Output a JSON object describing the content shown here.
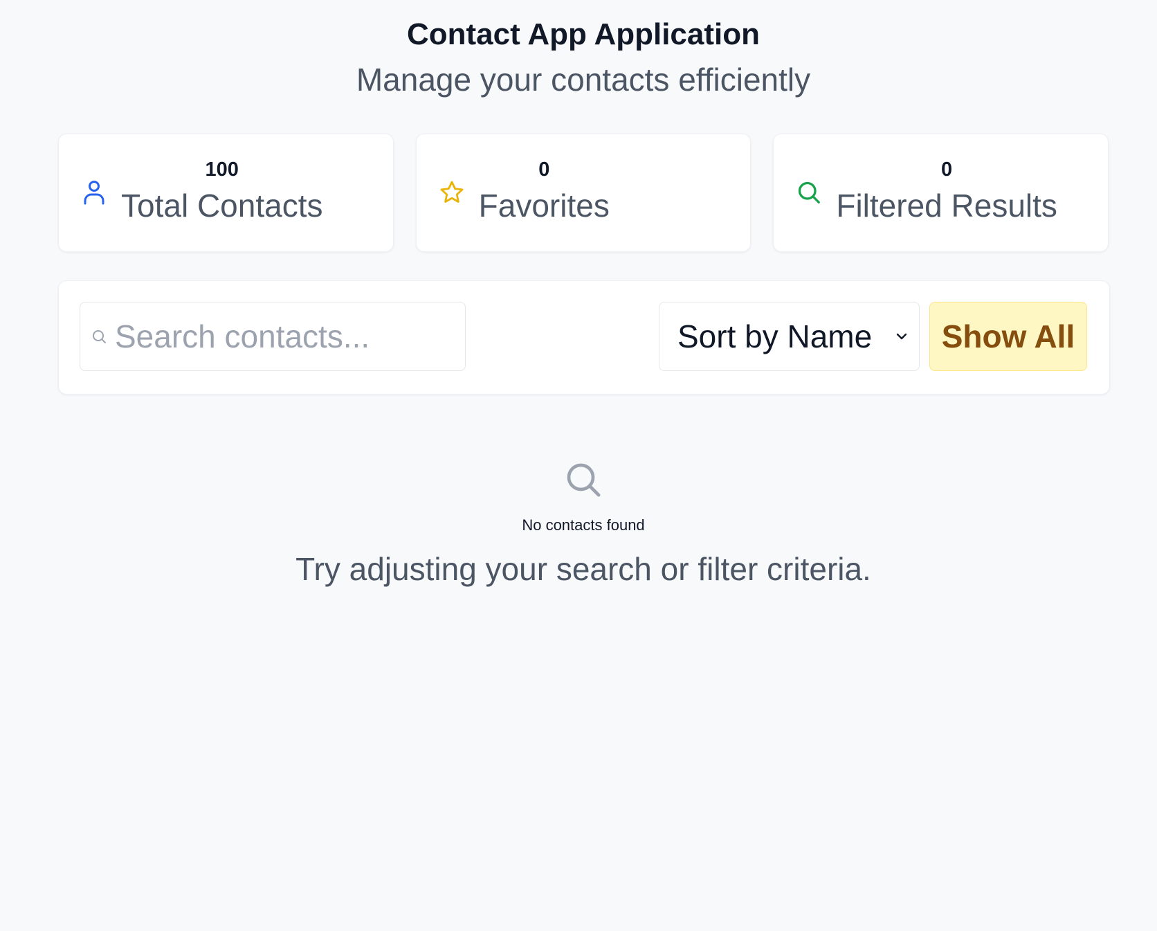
{
  "header": {
    "title": "Contact App Application",
    "subtitle": "Manage your contacts efficiently"
  },
  "stats": [
    {
      "value": "100",
      "label": "Total Contacts",
      "icon": "user-icon",
      "color": "#2563eb"
    },
    {
      "value": "0",
      "label": "Favorites",
      "icon": "star-icon",
      "color": "#eab308"
    },
    {
      "value": "0",
      "label": "Filtered Results",
      "icon": "search-icon",
      "color": "#16a34a"
    }
  ],
  "toolbar": {
    "search_placeholder": "Search contacts...",
    "search_value": "",
    "sort_selected": "Sort by Name",
    "show_all_label": "Show All"
  },
  "empty_state": {
    "title": "No contacts found",
    "message": "Try adjusting your search or filter criteria.",
    "icon": "search-icon"
  },
  "colors": {
    "background": "#f8f9fb",
    "card": "#ffffff",
    "show_all_bg": "#fef6c3",
    "show_all_text": "#854d0e"
  }
}
